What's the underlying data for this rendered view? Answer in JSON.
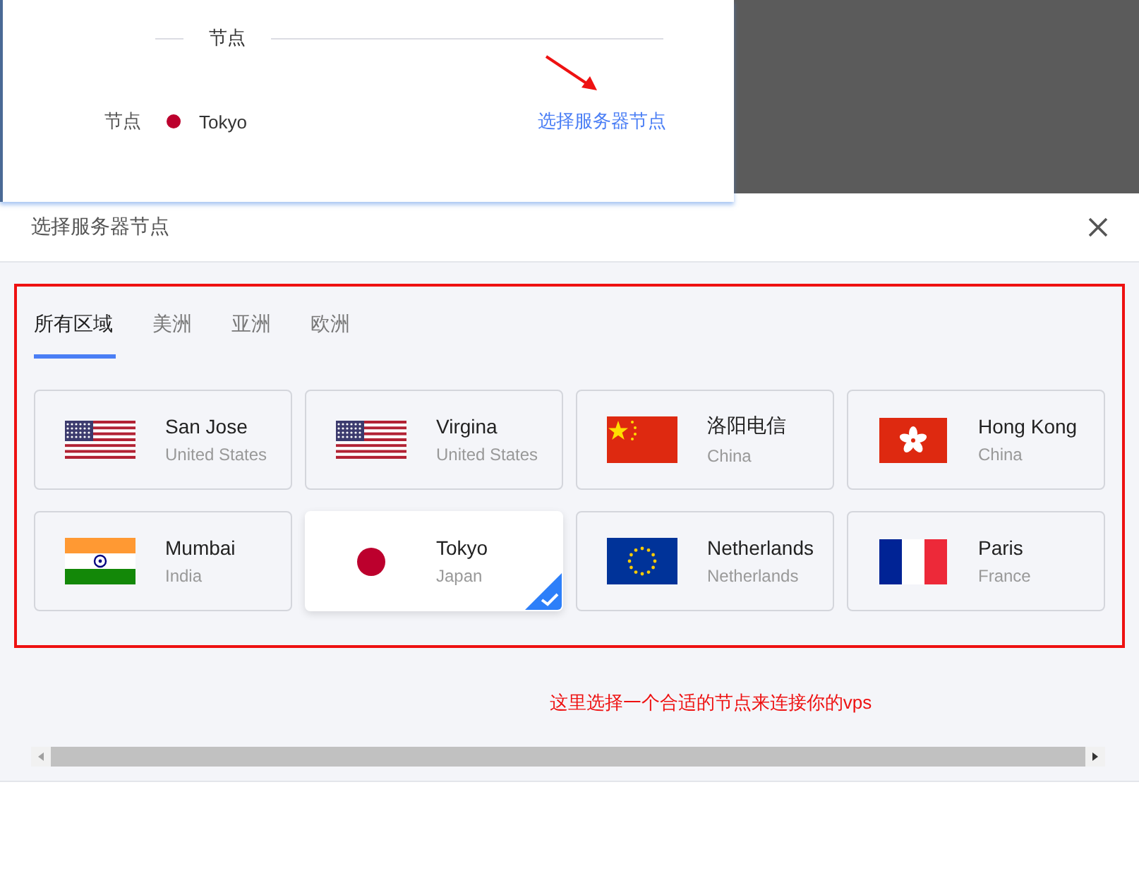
{
  "background_panel": {
    "section_title": "节点",
    "node_label": "节点",
    "node_value": "Tokyo",
    "link": "选择服务器节点"
  },
  "modal": {
    "title": "选择服务器节点",
    "tabs": [
      {
        "label": "所有区域",
        "selected": true
      },
      {
        "label": "美洲",
        "selected": false
      },
      {
        "label": "亚洲",
        "selected": false
      },
      {
        "label": "欧洲",
        "selected": false
      }
    ],
    "nodes": [
      {
        "city": "San Jose",
        "country": "United States",
        "kind": "us",
        "selected": false
      },
      {
        "city": "Virgina",
        "country": "United States",
        "kind": "us",
        "selected": false
      },
      {
        "city": "洛阳电信",
        "country": "China",
        "kind": "cn",
        "selected": false
      },
      {
        "city": "Hong Kong",
        "country": "China",
        "kind": "hk",
        "selected": false
      },
      {
        "city": "Mumbai",
        "country": "India",
        "kind": "in",
        "selected": false
      },
      {
        "city": "Tokyo",
        "country": "Japan",
        "kind": "jp",
        "selected": true
      },
      {
        "city": "Netherlands",
        "country": "Netherlands",
        "kind": "eu",
        "selected": false
      },
      {
        "city": "Paris",
        "country": "France",
        "kind": "fr",
        "selected": false
      }
    ],
    "note": "这里选择一个合适的节点来连接你的vps"
  }
}
